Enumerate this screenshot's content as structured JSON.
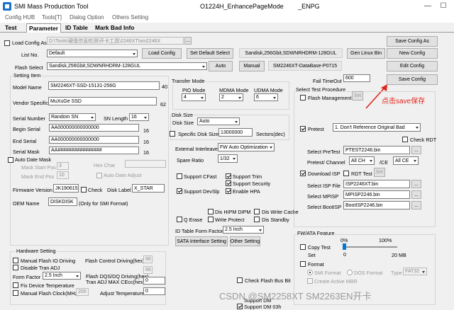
{
  "window": {
    "title": "SMI Mass Production Tool",
    "center_title": "O1224H_EnhancePageMode",
    "center_tag": "_ENPG",
    "minimize": "—",
    "maximize": "☐"
  },
  "menu": [
    "Config HUB",
    "Tools[T]",
    "Dialog Option",
    "Others Setting"
  ],
  "tabs": [
    "Test",
    "Parameter",
    "ID Table",
    "Mark Bad Info"
  ],
  "top": {
    "load_config_as_label": "Load Config As",
    "load_config_as_path": "D:\\Tools\\硬盘信息检测\\开卡工具\\2246XT\\sm2246X",
    "save_config_as": "Save Config As",
    "list_no_label": "List No.",
    "list_no_value": "Default",
    "load_config": "Load Config",
    "set_default_select": "Set Default Select",
    "sandisk_info": "Sandisk,256Gbit,SDWNRHDRM-128GUL",
    "gen_linux_bin": "Gen Linux Bin",
    "new_config": "New Config",
    "flash_select_label": "Flash Select",
    "flash_select_value": "Sandisk,256Gbit,SDWNRHDRM-128GUL",
    "auto": "Auto",
    "manual": "Manual",
    "database": "SM2246XT-DataBase-P0715",
    "edit_config": "Edit Config",
    "save_config": "Save Config"
  },
  "setting_item": {
    "title": "Setting Item",
    "model_name_label": "Model Name",
    "model_name": "SM2246XT-SSD-15131-256G",
    "model_len": "40",
    "vendor_label": "Vendor Specific",
    "vendor": "MuXuGe SSD",
    "vendor_len": "62",
    "serial_number_label": "Serial Number",
    "serial_number_mode": "Random SN",
    "sn_length_label": "SN Length",
    "sn_length": "16",
    "begin_serial_label": "Begin Serial",
    "begin_serial": "AA000000000000000",
    "begin_len": "16",
    "end_serial_label": "End Serial",
    "end_serial": "AA000000000000000",
    "end_len": "16",
    "serial_mask_label": "Serial Mask",
    "serial_mask": "AA################",
    "mask_len": "16",
    "auto_date_mask": "Auto Date Mask",
    "mask_start_pos_label": "Mask Start Pos",
    "mask_start_pos": "3",
    "hex_char": "Hex Char",
    "mask_end_pos_label": "Mask End Pos",
    "mask_end_pos": "10",
    "auto_date_adjust": "Auto Date Adjust",
    "firmware_version_label": "Firmware Version",
    "firmware_version": "JK190615",
    "check": "Check",
    "disk_label_label": "Disk Label",
    "disk_label": "X_STAR",
    "oem_name_label": "OEM Name",
    "oem_name": "DISKDISK",
    "oem_note": "(Only for SMI Format)"
  },
  "transfer_mode": {
    "title": "Transfer Mode",
    "pio_label": "PIO Mode",
    "pio": "4",
    "mdma_label": "MDMA Mode",
    "mdma": "2",
    "udma_label": "UDMA Mode",
    "udma": "6"
  },
  "disk_size": {
    "title": "Disk Size",
    "disk_size_label": "Disk Size",
    "disk_size": "Auto",
    "specific_label": "Specific Disk Size",
    "specific_value": "13000000",
    "sectors_label": "Sectors(dec)"
  },
  "middle": {
    "external_interleave_label": "External Interleave",
    "external_interleave": "FW Auto Optimization",
    "spare_ratio_label": "Spare Ratio",
    "spare_ratio": "1/32",
    "support_cfast": "Support CFast",
    "support_trim": "Support Trim",
    "support_security": "Support Security",
    "support_devslp": "Support DevSlp",
    "enable_hpa": "Enable HPA",
    "dis_hipm_dipm": "Dis HIPM DIPM",
    "dis_write_cache": "Dis Write Cache",
    "q_erase": "Q Erase",
    "write_protect": "Write Protect",
    "dis_standby": "Dis Standby",
    "id_table_form_factor_label": "ID Table Form Factor",
    "id_table_form_factor": "2.5 Inch",
    "sata_interface_setting": "SATA Interface Setting",
    "other_setting": "Other Setting"
  },
  "hardware": {
    "title": "Hardware Setting",
    "manual_flash_io_driving": "Manual Flash IO Driving",
    "flash_control_driving_label": "Flash Control Driving(hex)",
    "flash_control_driving": "66",
    "disable_tran_adj": "Disable Tran ADJ",
    "flash_dqs_value": "66",
    "form_factor_label": "Form Factor",
    "form_factor": "2.5 Inch",
    "flash_dqs_label": "Flash DQS/DQ Driving(hex)",
    "tran_adj_label": "Tran ADJ MAX CEcc(hex)",
    "tran_adj": "0",
    "fix_device_temperature": "Fix Device Temperature",
    "manual_flash_clock": "Manual Flash Clock(MHz)",
    "flash_clock": "200",
    "adjust_temperature_label": "Adjust Temperature",
    "adjust_temperature": "0",
    "check_flash_bus_bit": "Check Flash Bus Bit",
    "support_dm": "Support DM",
    "support_dm_03h": "Support DM 03h"
  },
  "right": {
    "fail_timeout_label": "Fail TimeOut",
    "fail_timeout": "600",
    "annotation": "点击save保存"
  },
  "test_procedure": {
    "title": "Select Test Procedure",
    "flash_management": "Flash Management",
    "set": "Set",
    "pretest_label": "Pretest",
    "pretest": "1. Don't Reference Original Bad",
    "check_rdt": "Check RDT",
    "select_pretest_label": "Select PreTest",
    "select_pretest": "PTEST2246.bin",
    "pretest_channel_label": "Pretest/ Channel",
    "pretest_channel": "All CH",
    "ce_label": "/CE",
    "ce": "All CE",
    "download_isp": "Download ISP",
    "rdt_test": "RDT Test",
    "rdt_set": "Set",
    "select_isp_label": "Select ISP File",
    "select_isp": "ISP2246XT.bin",
    "select_mpisp_label": "Select MPISP",
    "select_mpisp": "MPISP2246.bin",
    "select_bootisp_label": "Select BootISP",
    "select_bootisp": "BootISP2246.bin",
    "browse": "..."
  },
  "fw_ata": {
    "title": "FW/ATA Feature",
    "copy_test": "Copy Test",
    "set_label": "Set",
    "pct_min": "0%",
    "pct_max": "100%",
    "val_min": "0",
    "val_max": "20 MB",
    "format": "Format",
    "smi_format": "SMI Format",
    "dos_format": "DOS Format",
    "type_label": "Type",
    "type": "FAT32",
    "create_active_mbr": "Create Active MBR"
  },
  "watermark": "CSDN @SM2258XT SM2263EN开卡",
  "colors": {
    "accent": "#0078d7",
    "annotation": "#e0261c"
  },
  "slider": {
    "position_pct": 0
  }
}
